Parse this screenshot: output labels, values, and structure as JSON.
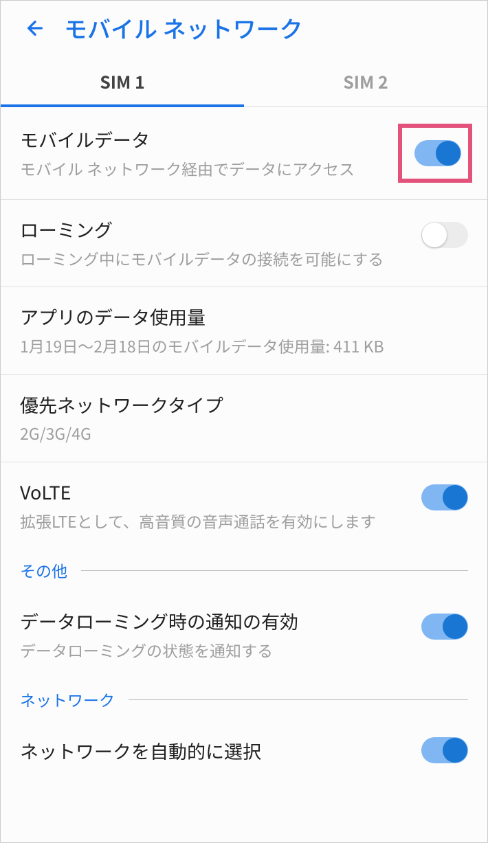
{
  "header": {
    "title": "モバイル ネットワーク"
  },
  "tabs": {
    "tab1": "SIM 1",
    "tab2": "SIM 2"
  },
  "mobile_data": {
    "title": "モバイルデータ",
    "subtitle": "モバイル ネットワーク経由でデータにアクセス",
    "enabled": true
  },
  "roaming": {
    "title": "ローミング",
    "subtitle": "ローミング中にモバイルデータの接続を可能にする",
    "enabled": false
  },
  "app_data_usage": {
    "title": "アプリのデータ使用量",
    "subtitle": "1月19日～2月18日のモバイルデータ使用量: 411 KB"
  },
  "preferred_network": {
    "title": "優先ネットワークタイプ",
    "subtitle": "2G/3G/4G"
  },
  "volte": {
    "title": "VoLTE",
    "subtitle": "拡張LTEとして、高音質の音声通話を有効にします",
    "enabled": true
  },
  "sections": {
    "other": "その他",
    "network": "ネットワーク"
  },
  "data_roaming_notify": {
    "title": "データローミング時の通知の有効",
    "subtitle": "データローミングの状態を通知する",
    "enabled": true
  },
  "auto_select_network": {
    "title": "ネットワークを自動的に選択",
    "enabled": true
  }
}
